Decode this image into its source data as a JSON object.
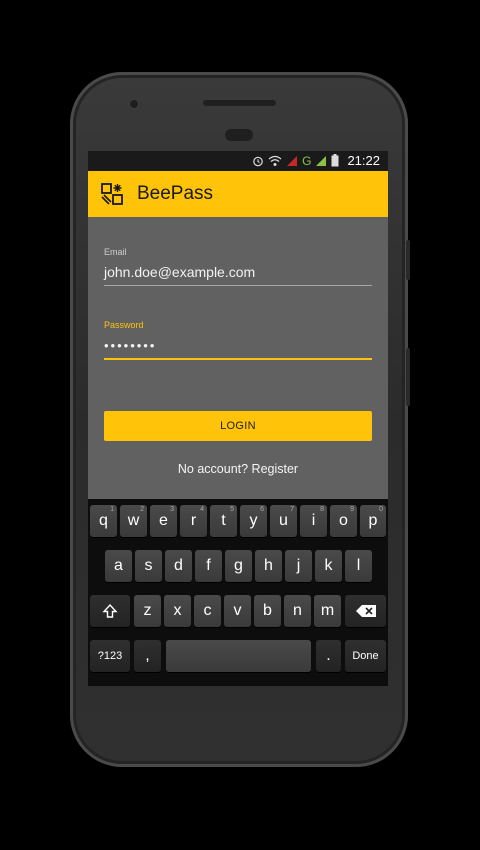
{
  "status_bar": {
    "time": "21:22",
    "icons": [
      "alarm-icon",
      "wifi-icon",
      "signal-icon",
      "network-type-g",
      "signal-icon-2",
      "battery-icon"
    ],
    "network_type": "G"
  },
  "app_bar": {
    "title": "BeePass",
    "icon": "beepass-logo-icon",
    "color": "#ffc30a"
  },
  "form": {
    "email_label": "Email",
    "email_value": "john.doe@example.com",
    "password_label": "Password",
    "password_value": "••••••••",
    "login_label": "LOGIN",
    "register_text": "No account? Register"
  },
  "keyboard": {
    "row1": [
      {
        "k": "q",
        "s": "1"
      },
      {
        "k": "w",
        "s": "2"
      },
      {
        "k": "e",
        "s": "3"
      },
      {
        "k": "r",
        "s": "4"
      },
      {
        "k": "t",
        "s": "5"
      },
      {
        "k": "y",
        "s": "6"
      },
      {
        "k": "u",
        "s": "7"
      },
      {
        "k": "i",
        "s": "8"
      },
      {
        "k": "o",
        "s": "9"
      },
      {
        "k": "p",
        "s": "0"
      }
    ],
    "row2": [
      "a",
      "s",
      "d",
      "f",
      "g",
      "h",
      "j",
      "k",
      "l"
    ],
    "row3": [
      "z",
      "x",
      "c",
      "v",
      "b",
      "n",
      "m"
    ],
    "symbols_label": "?123",
    "comma_label": ",",
    "period_label": ".",
    "done_label": "Done",
    "shift_icon": "shift-icon",
    "backspace_icon": "backspace-icon"
  }
}
